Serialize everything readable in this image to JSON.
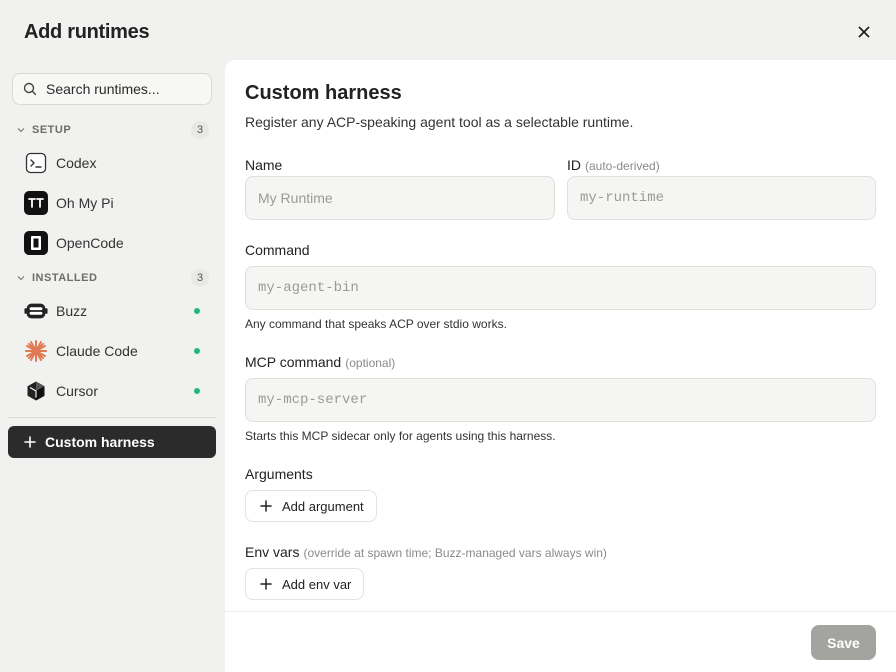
{
  "dialog": {
    "title": "Add runtimes",
    "close_icon": "close-icon"
  },
  "sidebar": {
    "search": {
      "placeholder": "Search runtimes..."
    },
    "sections": [
      {
        "name": "SETUP",
        "count": "3",
        "items": [
          {
            "label": "Codex",
            "icon": "terminal-icon"
          },
          {
            "label": "Oh My Pi",
            "icon": "oh-my-pi-icon"
          },
          {
            "label": "OpenCode",
            "icon": "opencode-icon"
          }
        ]
      },
      {
        "name": "INSTALLED",
        "count": "3",
        "items": [
          {
            "label": "Buzz",
            "icon": "buzz-icon",
            "status": "installed"
          },
          {
            "label": "Claude Code",
            "icon": "claude-icon",
            "status": "installed"
          },
          {
            "label": "Cursor",
            "icon": "cursor-icon",
            "status": "installed"
          }
        ]
      }
    ],
    "custom_button": {
      "label": "Custom harness",
      "icon": "plus-icon"
    }
  },
  "form": {
    "title": "Custom harness",
    "subtitle": "Register any ACP-speaking agent tool as a selectable runtime.",
    "name": {
      "label": "Name",
      "placeholder": "My Runtime"
    },
    "id": {
      "label": "ID",
      "hint": "(auto-derived)",
      "placeholder": "my-runtime"
    },
    "command": {
      "label": "Command",
      "placeholder": "my-agent-bin",
      "help": "Any command that speaks ACP over stdio works."
    },
    "mcp_command": {
      "label": "MCP command",
      "hint": "(optional)",
      "placeholder": "my-mcp-server",
      "help": "Starts this MCP sidecar only for agents using this harness."
    },
    "arguments": {
      "label": "Arguments",
      "button": "Add argument"
    },
    "env_vars": {
      "label": "Env vars",
      "hint": "(override at spawn time; Buzz-managed vars always win)",
      "button": "Add env var"
    },
    "save_label": "Save"
  },
  "colors": {
    "accent_dark": "#2b2b2b",
    "status_green": "#1fb87a",
    "save_disabled": "#a3a3a0",
    "claude_orange": "#e07a54"
  }
}
